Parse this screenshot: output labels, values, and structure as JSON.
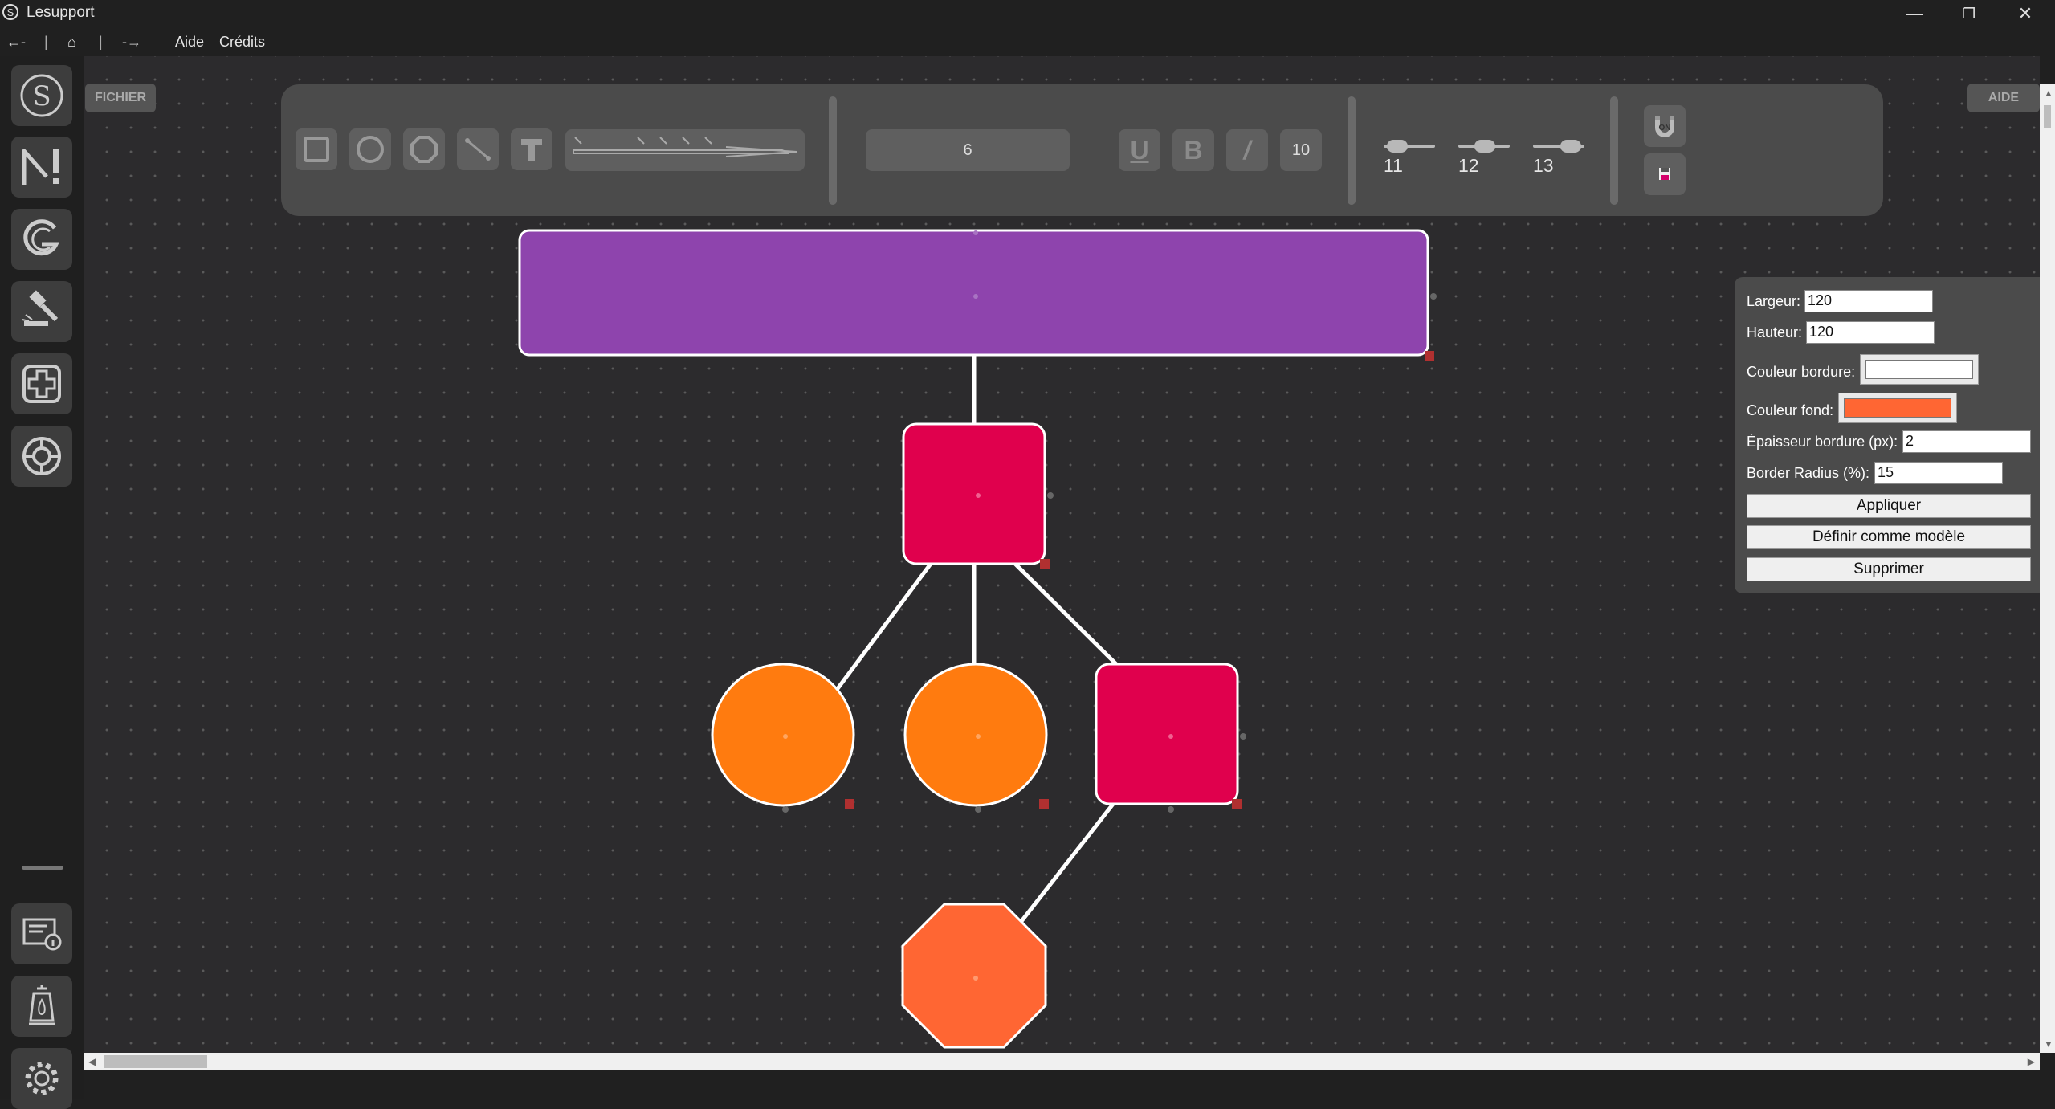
{
  "window": {
    "title": "Lesupport",
    "logo_letter": "S",
    "minimize_label": "—",
    "maximize_label": "❐",
    "close_label": "✕"
  },
  "menubar": {
    "back_label": "←-",
    "sep1": "|",
    "home_label": "⌂",
    "sep2": "|",
    "forward_label": "-→",
    "aide": "Aide",
    "credits": "Crédits"
  },
  "sidebar": {
    "items": [
      "s-logo-icon",
      "alert-icon",
      "g-letter-icon",
      "gavel-icon",
      "plus-icon",
      "lifebuoy-icon"
    ],
    "bottom_items": [
      "info-list-icon",
      "lantern-icon",
      "gear-icon"
    ]
  },
  "canvas": {
    "fichier_label": "FICHIER",
    "aide_label": "AIDE"
  },
  "toolbar": {
    "shape_tools": [
      "square-tool-icon",
      "circle-tool-icon",
      "octagon-tool-icon",
      "line-tool-icon",
      "text-tool-icon"
    ],
    "arrow_tool": "arrow-tool-icon",
    "font_size_value": "6",
    "underline_label": "U",
    "bold_label": "B",
    "italic_label": "/",
    "text_size_value": "10",
    "stroke_widths": [
      "11",
      "12",
      "13"
    ],
    "magnet_icon": "magnet-icon",
    "save_icon": "save-icon"
  },
  "diagram": {
    "colors": {
      "purple": "#8e44ad",
      "crimson": "#e0004d",
      "orange": "#ff7b0f",
      "coral": "#ff6633",
      "border": "#ffffff",
      "connector": "#ffffff",
      "handle": "#b03030"
    },
    "shapes": [
      "rectangle",
      "rounded-square",
      "circle",
      "circle",
      "rounded-square",
      "octagon"
    ]
  },
  "properties": {
    "width_label": "Largeur:",
    "width_value": "120",
    "height_label": "Hauteur:",
    "height_value": "120",
    "border_color_label": "Couleur bordure:",
    "border_color_value": "#ffffff",
    "fill_color_label": "Couleur fond:",
    "fill_color_value": "#ff6633",
    "border_width_label": "Épaisseur bordure (px):",
    "border_width_value": "2",
    "radius_label": "Border Radius (%):",
    "radius_value": "15",
    "apply_button": "Appliquer",
    "template_button": "Définir comme modèle",
    "delete_button": "Supprimer"
  }
}
